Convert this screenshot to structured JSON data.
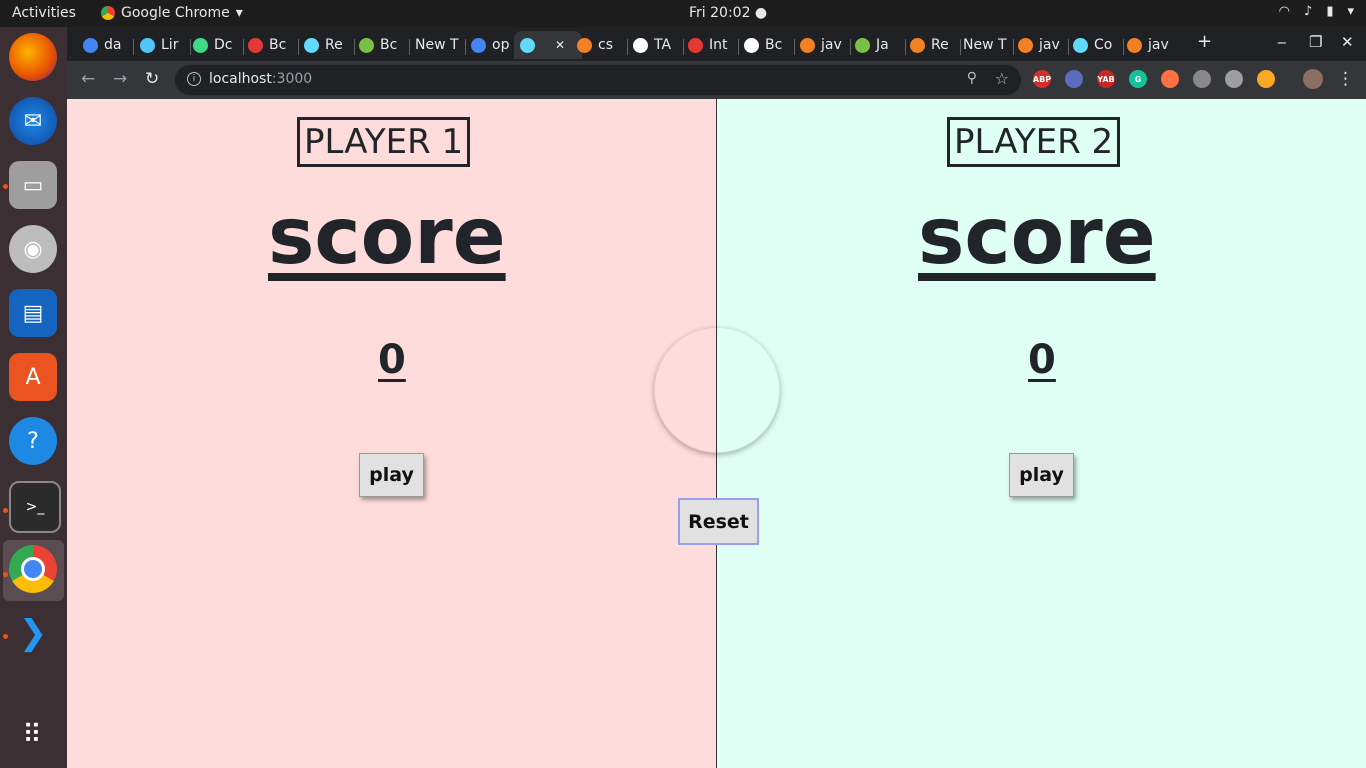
{
  "system": {
    "activities_label": "Activities",
    "app_name": "Google Chrome",
    "clock": "Fri 20:02 ●"
  },
  "dock": {
    "items": [
      {
        "name": "firefox-icon"
      },
      {
        "name": "thunderbird-icon"
      },
      {
        "name": "files-icon"
      },
      {
        "name": "rhythmbox-icon"
      },
      {
        "name": "writer-icon"
      },
      {
        "name": "software-icon"
      },
      {
        "name": "help-icon"
      },
      {
        "name": "terminal-icon"
      },
      {
        "name": "chrome-icon"
      },
      {
        "name": "vscode-icon"
      },
      {
        "name": "app-grid-icon"
      }
    ]
  },
  "browser": {
    "tabs": [
      {
        "label": "da",
        "color": "#4285f4"
      },
      {
        "label": "Lir",
        "color": "#54c5f8"
      },
      {
        "label": "Dc",
        "color": "#3ddc84"
      },
      {
        "label": "Bc",
        "color": "#e53935"
      },
      {
        "label": "Re",
        "color": "#61dafb"
      },
      {
        "label": "Bc",
        "color": "#7ac143"
      },
      {
        "label": "New T",
        "color": ""
      },
      {
        "label": "op",
        "color": "#4285f4"
      },
      {
        "label": "",
        "color": "#61dafb"
      },
      {
        "label": "cs",
        "color": "#f48024"
      },
      {
        "label": "TA",
        "color": "#ffffff"
      },
      {
        "label": "Int",
        "color": "#e53935"
      },
      {
        "label": "Bc",
        "color": "#ffffff"
      },
      {
        "label": "jav",
        "color": "#f48024"
      },
      {
        "label": "Ja",
        "color": "#7ac143"
      },
      {
        "label": "Re",
        "color": "#f48024"
      },
      {
        "label": "New T",
        "color": ""
      },
      {
        "label": "jav",
        "color": "#f48024"
      },
      {
        "label": "Co",
        "color": "#61dafb"
      },
      {
        "label": "jav",
        "color": "#f48024"
      }
    ],
    "new_tab_symbol": "+",
    "url_host": "localhost",
    "url_port": ":3000",
    "extensions": [
      {
        "label": "ABP",
        "color": "#d32f2f"
      },
      {
        "label": "",
        "color": "#5c6bc0"
      },
      {
        "label": "YAB",
        "color": "#c62828"
      },
      {
        "label": "G",
        "color": "#15c39a"
      },
      {
        "label": "",
        "color": "#ff7043"
      },
      {
        "label": "",
        "color": "#888888"
      },
      {
        "label": "",
        "color": "#9e9e9e"
      },
      {
        "label": "",
        "color": "#f9a825"
      }
    ]
  },
  "game": {
    "player1": {
      "label": "PLAYER 1",
      "score_label": "score",
      "score": "0",
      "play_label": "play",
      "background": "#ffdcdc"
    },
    "player2": {
      "label": "PLAYER 2",
      "score_label": "score",
      "score": "0",
      "play_label": "play",
      "background": "#e0fff4"
    },
    "reset_label": "Reset"
  }
}
